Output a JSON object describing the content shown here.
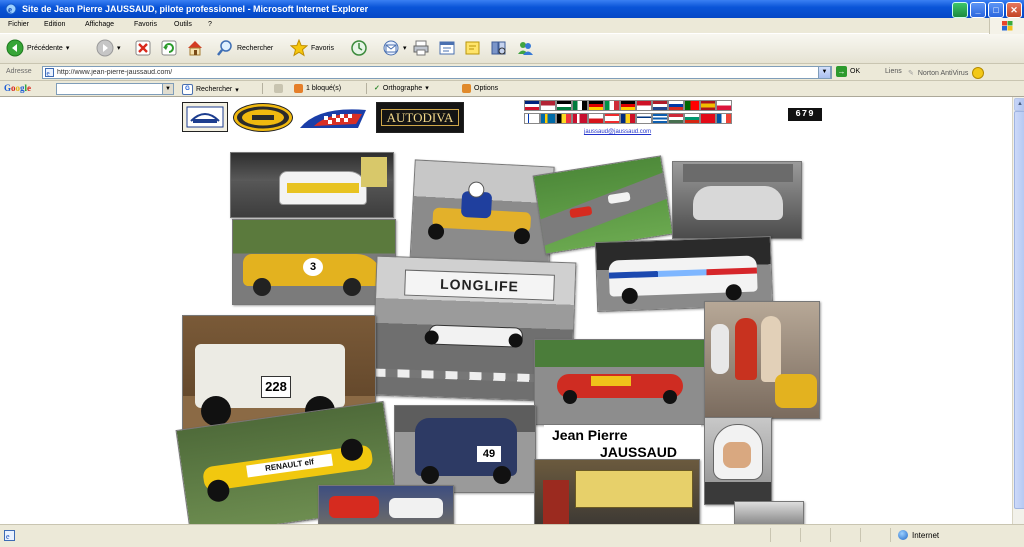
{
  "window": {
    "title": "Site de Jean Pierre JAUSSAUD, pilote professionnel - Microsoft Internet Explorer"
  },
  "menu": [
    "Fichier",
    "Edition",
    "Affichage",
    "Favoris",
    "Outils",
    "?"
  ],
  "toolbar": {
    "back_label": "Précédente",
    "search_label": "Rechercher",
    "favorites_label": "Favoris"
  },
  "address": {
    "label": "Adresse",
    "url": "http://www.jean-pierre-jaussaud.com/",
    "go_label": "OK",
    "links_label": "Liens",
    "norton_label": "Norton AntiVirus"
  },
  "googlebar": {
    "logo_letters": [
      "G",
      "o",
      "o",
      "g",
      "l",
      "e"
    ],
    "search_label": "Rechercher",
    "blocked_label": "1 bloqué(s)",
    "spell_label": "Orthographe",
    "options_label": "Options"
  },
  "page": {
    "logo_text": "AUTODIVA",
    "counter": "679",
    "email": "jaussaud@jaussaud.com",
    "name_line1": "Jean Pierre",
    "name_line2": "JAUSSAUD",
    "car_numbers": {
      "truck": "228",
      "van": "49"
    },
    "banner_text": "LONGLIFE",
    "sponsor_text": "RENAULT elf"
  },
  "status": {
    "zone_label": "Internet"
  }
}
